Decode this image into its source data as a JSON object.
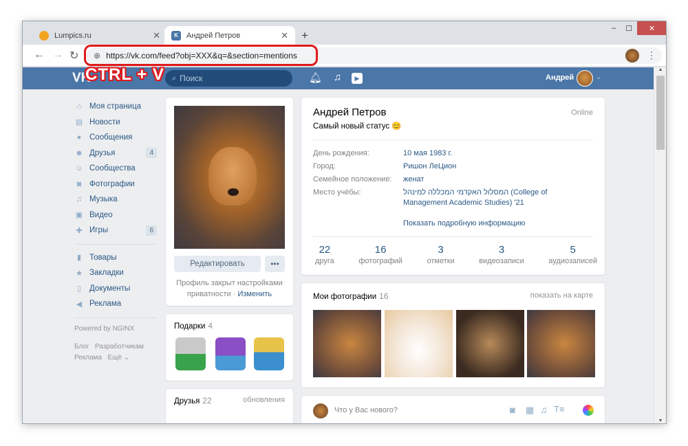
{
  "browser": {
    "tabs": [
      {
        "title": "Lumpics.ru",
        "favicon_color": "#f3a41f"
      },
      {
        "title": "Андрей Петров",
        "favicon_color": "#4a76a8"
      }
    ],
    "url": "https://vk.com/feed?obj=XXX&q=&section=mentions",
    "annotation": "CTRL + V"
  },
  "header": {
    "logo": "VK",
    "search_placeholder": "Поиск",
    "user_name": "Андрей"
  },
  "menu": {
    "items": [
      {
        "label": "Моя страница",
        "icon": "home-icon"
      },
      {
        "label": "Новости",
        "icon": "news-icon"
      },
      {
        "label": "Сообщения",
        "icon": "messages-icon"
      },
      {
        "label": "Друзья",
        "icon": "friends-icon",
        "badge": "4"
      },
      {
        "label": "Сообщества",
        "icon": "groups-icon"
      },
      {
        "label": "Фотографии",
        "icon": "camera-icon"
      },
      {
        "label": "Музыка",
        "icon": "music-icon"
      },
      {
        "label": "Видео",
        "icon": "video-icon"
      },
      {
        "label": "Игры",
        "icon": "gamepad-icon",
        "badge": "6"
      }
    ],
    "items2": [
      {
        "label": "Товары",
        "icon": "bag-icon"
      },
      {
        "label": "Закладки",
        "icon": "star-icon"
      },
      {
        "label": "Документы",
        "icon": "document-icon"
      },
      {
        "label": "Реклама",
        "icon": "megaphone-icon"
      }
    ],
    "powered": "Powered by NGINX",
    "links": [
      "Блог",
      "Разработчикам",
      "Реклама",
      "Ещё"
    ]
  },
  "profile": {
    "edit": "Редактировать",
    "privacy_text": "Профиль закрыт настройками приватности ·",
    "privacy_link": "Изменить",
    "name": "Андрей Петров",
    "online": "Online",
    "status": "Самый новый статус 😊",
    "fields": [
      {
        "label": "День рождения:",
        "value": "10 мая 1983 г."
      },
      {
        "label": "Город:",
        "value": "Ришон ЛеЦион"
      },
      {
        "label": "Семейное положение:",
        "value": "женат"
      },
      {
        "label": "Место учёбы:",
        "value": "המסלול האקדמי המכללה למינהל (College of Management Academic Studies) '21"
      }
    ],
    "more": "Показать подробную информацию",
    "counters": [
      {
        "n": "22",
        "l": "друга"
      },
      {
        "n": "16",
        "l": "фотографий"
      },
      {
        "n": "3",
        "l": "отметки"
      },
      {
        "n": "3",
        "l": "видеозаписи"
      },
      {
        "n": "5",
        "l": "аудиозаписей"
      }
    ]
  },
  "gifts": {
    "title": "Подарки",
    "count": "4"
  },
  "friends": {
    "title": "Друзья",
    "count": "22",
    "updates": "обновления"
  },
  "photos": {
    "title": "Мои фотографии",
    "count": "16",
    "map": "показать на карте"
  },
  "post": {
    "placeholder": "Что у Вас нового?"
  }
}
